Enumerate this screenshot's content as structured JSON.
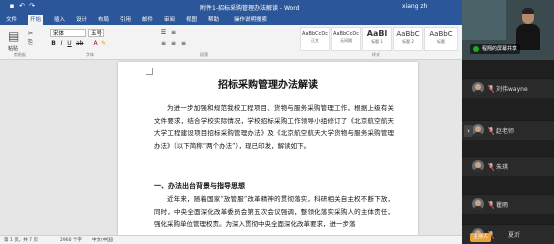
{
  "window": {
    "title": "附件1-招标采购管理办法解读 - Word",
    "user": "xiang zh"
  },
  "menu": {
    "items": [
      "文件",
      "开始",
      "插入",
      "设计",
      "布局",
      "引用",
      "邮件",
      "审阅",
      "视图",
      "帮助",
      "操作说明搜索"
    ],
    "active_index": 1
  },
  "ribbon": {
    "paste_label": "粘贴",
    "font_name": "宋体",
    "font_size": "五号",
    "styles": [
      {
        "sample": "AaBbCcDc",
        "name": "正文"
      },
      {
        "sample": "AaBbCcDc",
        "name": "无间隔"
      },
      {
        "sample": "AaBl",
        "name": "标题 1"
      },
      {
        "sample": "AaBbC",
        "name": "标题 2"
      },
      {
        "sample": "AaBbC",
        "name": "标题"
      }
    ],
    "groups": [
      "剪贴板",
      "字体",
      "段落",
      "样式"
    ]
  },
  "document": {
    "title": "招标采购管理办法解读",
    "para1": "为进一步加强和规范我校工程项目、货物与服务采购管理工作，根据上级有关文件要求，结合学校实际情况，学校招标采购工作领导小组修订了《北京航空航天大学工程建设项目招标采购管理办法》及《北京航空航天大学货物与服务采购管理办法》（以下简称“两个办法”），现已印发，解读如下。",
    "heading1": "一、办法出台背景与指导思想",
    "para2": "近年来，随着国家“放管服”改革精神的贯彻落实，科研相关自主权不断下放，同时，中央全面深化改革委员会第五次会议强调，整领化落实采购人的主体责任，强化采购单位管理权责。为深入贯彻中央全面深化改革要求，进一步落"
  },
  "status": {
    "page": "第 1 页，共 7 页",
    "words": "2960 个字",
    "lang": "中文(中国)"
  },
  "meeting": {
    "share_label": "程翔的屏幕共享",
    "participants": [
      "刘伟wayne",
      "赵老师",
      "朱琪",
      "瞿雨",
      "夏沂"
    ],
    "host_tag": "主持人"
  },
  "colors": {
    "word_blue": "#2b579a",
    "panel_bg": "#1f1f1f",
    "share_dot": "#1aad19",
    "host_tag": "#e6a23c"
  }
}
